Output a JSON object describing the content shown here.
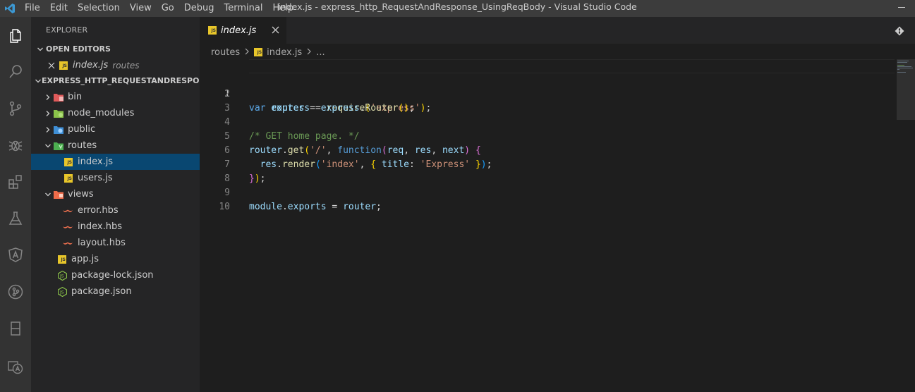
{
  "window": {
    "title": "index.js - express_http_RequestAndResponse_UsingReqBody - Visual Studio Code"
  },
  "menu": [
    "File",
    "Edit",
    "Selection",
    "View",
    "Go",
    "Debug",
    "Terminal",
    "Help"
  ],
  "activity_bar": [
    "explorer-icon",
    "search-icon",
    "source-control-icon",
    "debug-icon",
    "extensions-icon",
    "flask-icon",
    "angular-icon",
    "git-graph-icon",
    "panel-icon",
    "translate-icon"
  ],
  "sidebar": {
    "title": "EXPLORER",
    "open_editors": {
      "label": "OPEN EDITORS",
      "items": [
        {
          "name": "index.js",
          "desc": "routes"
        }
      ]
    },
    "folder": {
      "label": "EXPRESS_HTTP_REQUESTANDRESPON...",
      "tree": [
        {
          "name": "bin",
          "type": "folder",
          "expanded": false
        },
        {
          "name": "node_modules",
          "type": "folder",
          "expanded": false
        },
        {
          "name": "public",
          "type": "folder",
          "expanded": false
        },
        {
          "name": "routes",
          "type": "folder",
          "expanded": true
        },
        {
          "name": "index.js",
          "type": "js",
          "selected": true
        },
        {
          "name": "users.js",
          "type": "js"
        },
        {
          "name": "views",
          "type": "folder",
          "expanded": true
        },
        {
          "name": "error.hbs",
          "type": "hbs"
        },
        {
          "name": "index.hbs",
          "type": "hbs"
        },
        {
          "name": "layout.hbs",
          "type": "hbs"
        },
        {
          "name": "app.js",
          "type": "js"
        },
        {
          "name": "package-lock.json",
          "type": "json"
        },
        {
          "name": "package.json",
          "type": "json"
        }
      ]
    }
  },
  "editor": {
    "tab": {
      "label": "index.js",
      "icon": "JS"
    },
    "breadcrumbs": [
      "routes",
      "index.js",
      "..."
    ],
    "active_line": 1,
    "lines": [
      {
        "n": "1",
        "text": "var express = require('express');"
      },
      {
        "n": "2",
        "text": "var router = express.Router();"
      },
      {
        "n": "3",
        "text": ""
      },
      {
        "n": "4",
        "text": "/* GET home page. */"
      },
      {
        "n": "5",
        "text": "router.get('/', function(req, res, next) {"
      },
      {
        "n": "6",
        "text": "  res.render('index', { title: 'Express' });"
      },
      {
        "n": "7",
        "text": "});"
      },
      {
        "n": "8",
        "text": ""
      },
      {
        "n": "9",
        "text": "module.exports = router;"
      },
      {
        "n": "10",
        "text": ""
      }
    ]
  },
  "colors": {
    "title_bar": "#3c3c3c",
    "activity_bar": "#333333",
    "sidebar": "#252526",
    "editor": "#1e1e1e",
    "selection": "#094771",
    "accent": "#007acc"
  }
}
